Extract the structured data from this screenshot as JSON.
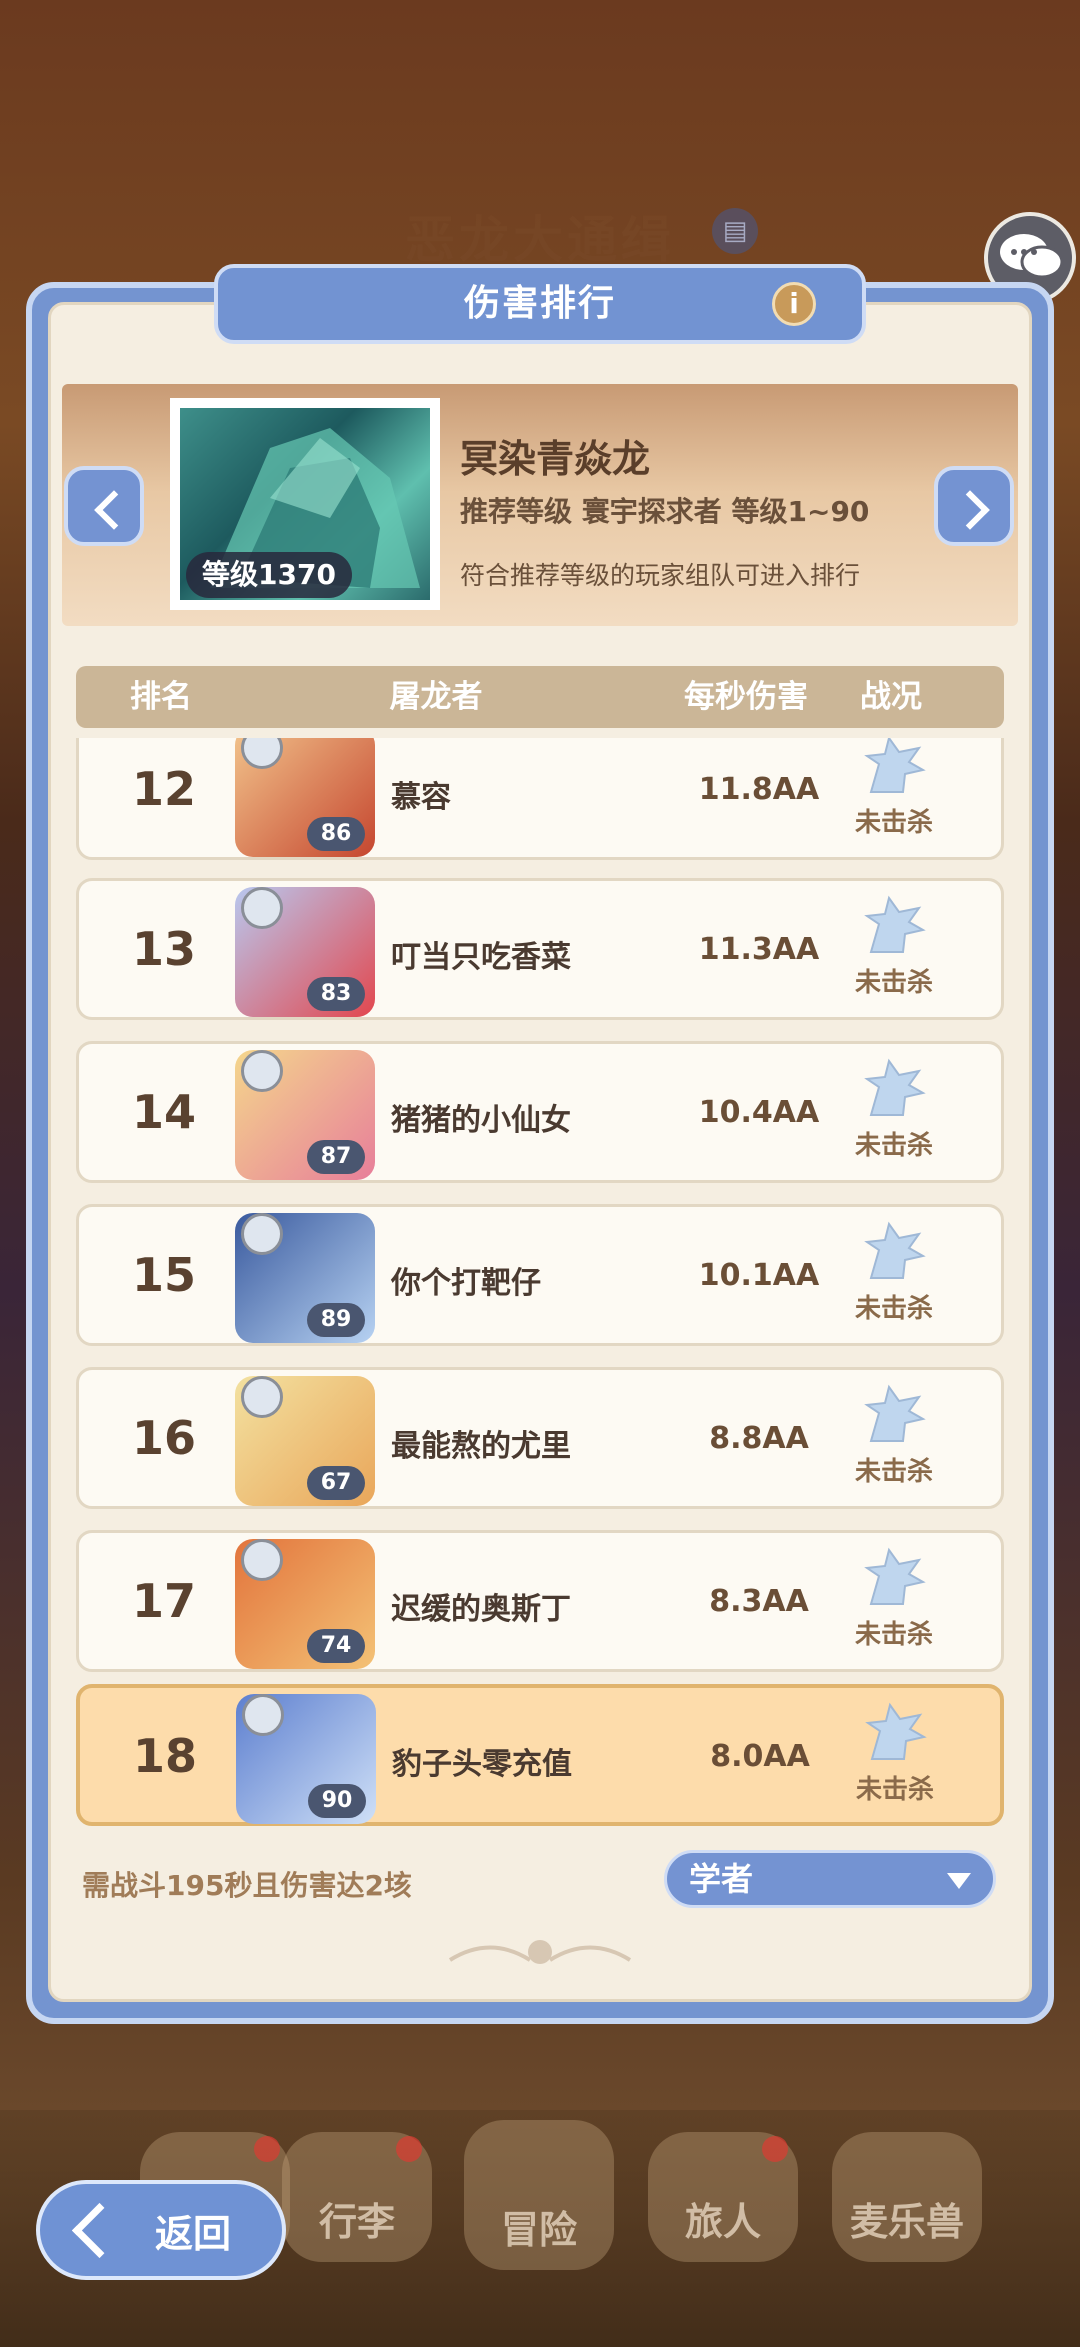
{
  "background": {
    "event_title": "恶龙大通缉"
  },
  "panel": {
    "title": "伤害排行",
    "info_icon": "info-icon"
  },
  "boss": {
    "level_badge": "等级1370",
    "name": "冥染青焱龙",
    "recommendation": "推荐等级  寰宇探求者  等级1~90",
    "note": "符合推荐等级的玩家组队可进入排行"
  },
  "table": {
    "headers": [
      "排名",
      "屠龙者",
      "每秒伤害",
      "战况"
    ],
    "rows": [
      {
        "rank": "12",
        "name": "慕容",
        "level": "86",
        "dps": "11.8AA",
        "status": "未击杀",
        "colors": [
          "#f2c48c",
          "#c5462f"
        ]
      },
      {
        "rank": "13",
        "name": "叮当只吃香菜",
        "level": "83",
        "dps": "11.3AA",
        "status": "未击杀",
        "colors": [
          "#b8c8ef",
          "#e2474e"
        ]
      },
      {
        "rank": "14",
        "name": "猪猪的小仙女",
        "level": "87",
        "dps": "10.4AA",
        "status": "未击杀",
        "colors": [
          "#f4d68c",
          "#e77e9a"
        ]
      },
      {
        "rank": "15",
        "name": "你个打靶仔",
        "level": "89",
        "dps": "10.1AA",
        "status": "未击杀",
        "colors": [
          "#3a5a9e",
          "#b7d2f2"
        ]
      },
      {
        "rank": "16",
        "name": "最能熬的尤里",
        "level": "67",
        "dps": "8.8AA",
        "status": "未击杀",
        "colors": [
          "#f3e1a0",
          "#e9a65a"
        ]
      },
      {
        "rank": "17",
        "name": "迟缓的奥斯丁",
        "level": "74",
        "dps": "8.3AA",
        "status": "未击杀",
        "colors": [
          "#e2743c",
          "#f4c276"
        ]
      },
      {
        "rank": "18",
        "name": "豹子头零充值",
        "level": "90",
        "dps": "8.0AA",
        "status": "未击杀",
        "colors": [
          "#5d7fcf",
          "#cfe0f7"
        ]
      }
    ]
  },
  "footer": {
    "requirement": "需战斗195秒且伤害达2垓",
    "selected_class": "学者"
  },
  "bottom_nav": {
    "back_label": "返回",
    "items": [
      "行李",
      "冒险",
      "旅人",
      "麦乐兽"
    ]
  }
}
